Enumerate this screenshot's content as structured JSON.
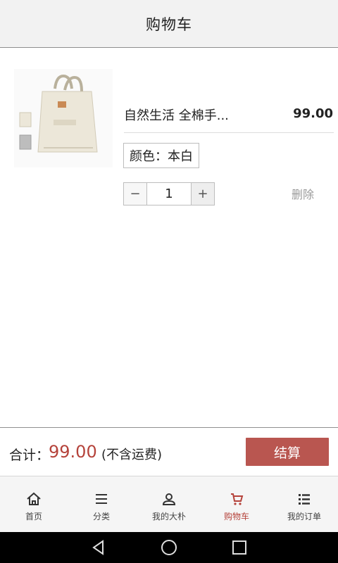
{
  "header": {
    "title": "购物车"
  },
  "cart": {
    "items": [
      {
        "name": "自然生活  全棉手...",
        "price": "99.00",
        "variant": "颜色：本白",
        "quantity": "1",
        "delete_label": "删除",
        "thumb_icon": "tote-bag-image"
      }
    ]
  },
  "checkout": {
    "total_label": "合计：",
    "total_amount": "99.00",
    "note": "(不含运费)",
    "button_label": "结算"
  },
  "tabs": [
    {
      "label": "首页",
      "icon": "home-icon"
    },
    {
      "label": "分类",
      "icon": "menu-icon"
    },
    {
      "label": "我的大朴",
      "icon": "user-icon"
    },
    {
      "label": "购物车",
      "icon": "cart-icon",
      "active": true
    },
    {
      "label": "我的订单",
      "icon": "list-icon"
    }
  ],
  "stepper": {
    "minus": "−",
    "plus": "+"
  },
  "colors": {
    "accent": "#b5433b",
    "button": "#b95650",
    "header_bg": "#f2f2f2"
  }
}
